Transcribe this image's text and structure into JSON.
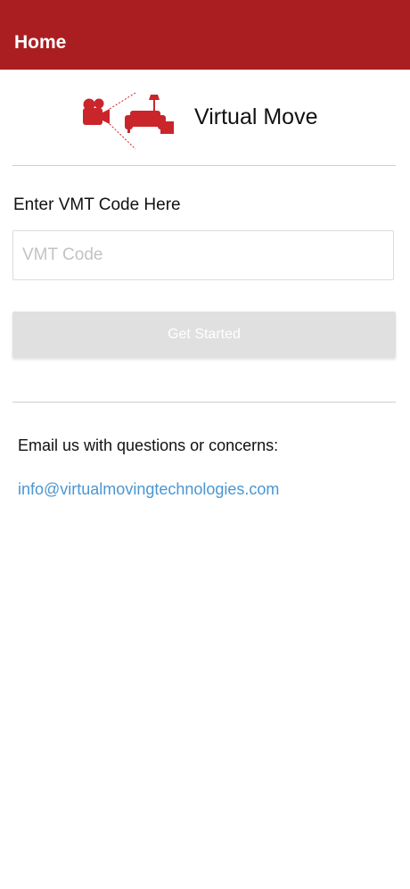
{
  "header": {
    "title": "Home",
    "background_color": "#aa1e22"
  },
  "logo": {
    "text": "Virtual Move",
    "icon": "camera-couch-logo-icon",
    "color": "#c9252b"
  },
  "form": {
    "label": "Enter VMT Code Here",
    "input_placeholder": "VMT Code",
    "input_value": "",
    "button_label": "Get Started",
    "button_state": "disabled"
  },
  "contact": {
    "text": "Email us with questions or concerns:",
    "email": "info@virtualmovingtechnologies.com",
    "link_color": "#4a96d2"
  }
}
